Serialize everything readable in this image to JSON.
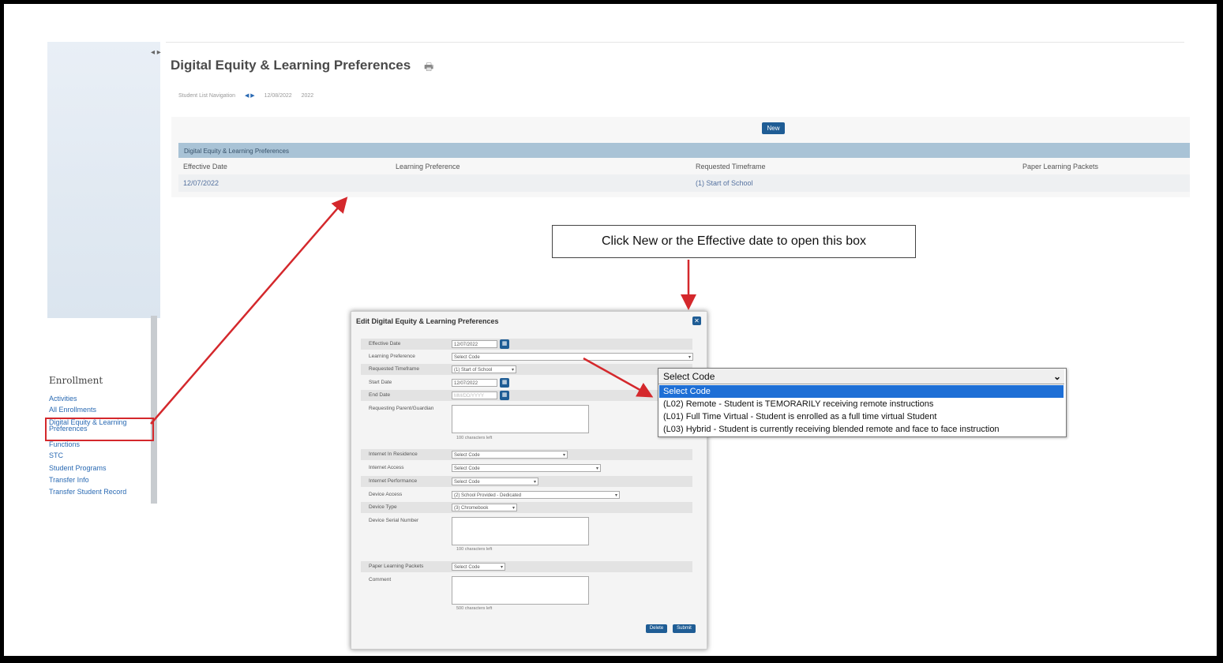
{
  "page": {
    "title": "Digital Equity & Learning Preferences",
    "breadcrumbs": [
      "Student List Navigation",
      "12/08/2022",
      "2022"
    ]
  },
  "sidebar": {
    "section_title": "Enrollment",
    "items": [
      {
        "label": "Activities"
      },
      {
        "label": "All Enrollments"
      },
      {
        "label": "Digital Equity & Learning Preferences"
      },
      {
        "label": "Functions"
      },
      {
        "label": "STC"
      },
      {
        "label": "Student Programs"
      },
      {
        "label": "Transfer Info"
      },
      {
        "label": "Transfer Student Record"
      }
    ]
  },
  "list": {
    "new_label": "New",
    "grid_title": "Digital Equity & Learning Preferences",
    "columns": [
      "Effective Date",
      "Learning Preference",
      "Requested Timeframe",
      "Paper Learning Packets"
    ],
    "rows": [
      {
        "effective_date": "12/07/2022",
        "learning_preference": "",
        "requested_timeframe": "(1) Start of School",
        "paper_packets": ""
      }
    ]
  },
  "callout": {
    "text": "Click New or the Effective date to open this box"
  },
  "modal": {
    "title": "Edit Digital Equity & Learning Preferences",
    "close_icon": "close-icon",
    "fields": {
      "effective_date_label": "Effective Date",
      "effective_date_value": "12/07/2022",
      "learning_preference_label": "Learning Preference",
      "learning_preference_value": "Select Code",
      "requested_timeframe_label": "Requested Timeframe",
      "requested_timeframe_value": "(1) Start of School",
      "start_date_label": "Start Date",
      "start_date_value": "12/07/2022",
      "end_date_label": "End Date",
      "end_date_placeholder": "MM/DD/YYYY",
      "requesting_parent_label": "Requesting Parent/Guardian",
      "requesting_parent_hint": "100 characters left",
      "internet_residence_label": "Internet In Residence",
      "internet_residence_value": "Select Code",
      "internet_access_label": "Internet Access",
      "internet_access_value": "Select Code",
      "internet_performance_label": "Internet Performance",
      "internet_performance_value": "Select Code",
      "device_access_label": "Device Access",
      "device_access_value": "(2) School Provided - Dedicated",
      "device_type_label": "Device Type",
      "device_type_value": "(3) Chromebook",
      "device_serial_label": "Device Serial Number",
      "device_serial_hint": "100 characters left",
      "paper_packets_label": "Paper Learning Packets",
      "paper_packets_value": "Select Code",
      "comment_label": "Comment",
      "comment_hint": "500 characters left"
    },
    "delete_label": "Delete",
    "submit_label": "Submit"
  },
  "dropdown": {
    "current": "Select Code",
    "options": [
      {
        "label": "Select Code",
        "selected": true
      },
      {
        "label": "(L02) Remote - Student is TEMORARILY receiving remote instructions",
        "selected": false
      },
      {
        "label": "(L01) Full Time Virtual - Student is enrolled as a full time virtual Student",
        "selected": false
      },
      {
        "label": "(L03) Hybrid - Student is currently receiving blended remote and face to face instruction",
        "selected": false
      }
    ]
  },
  "colors": {
    "annotation_red": "#d4282c",
    "button_blue": "#1f5d95",
    "selected_option_blue": "#1e6fd6",
    "grid_header": "#a9c3d6"
  }
}
